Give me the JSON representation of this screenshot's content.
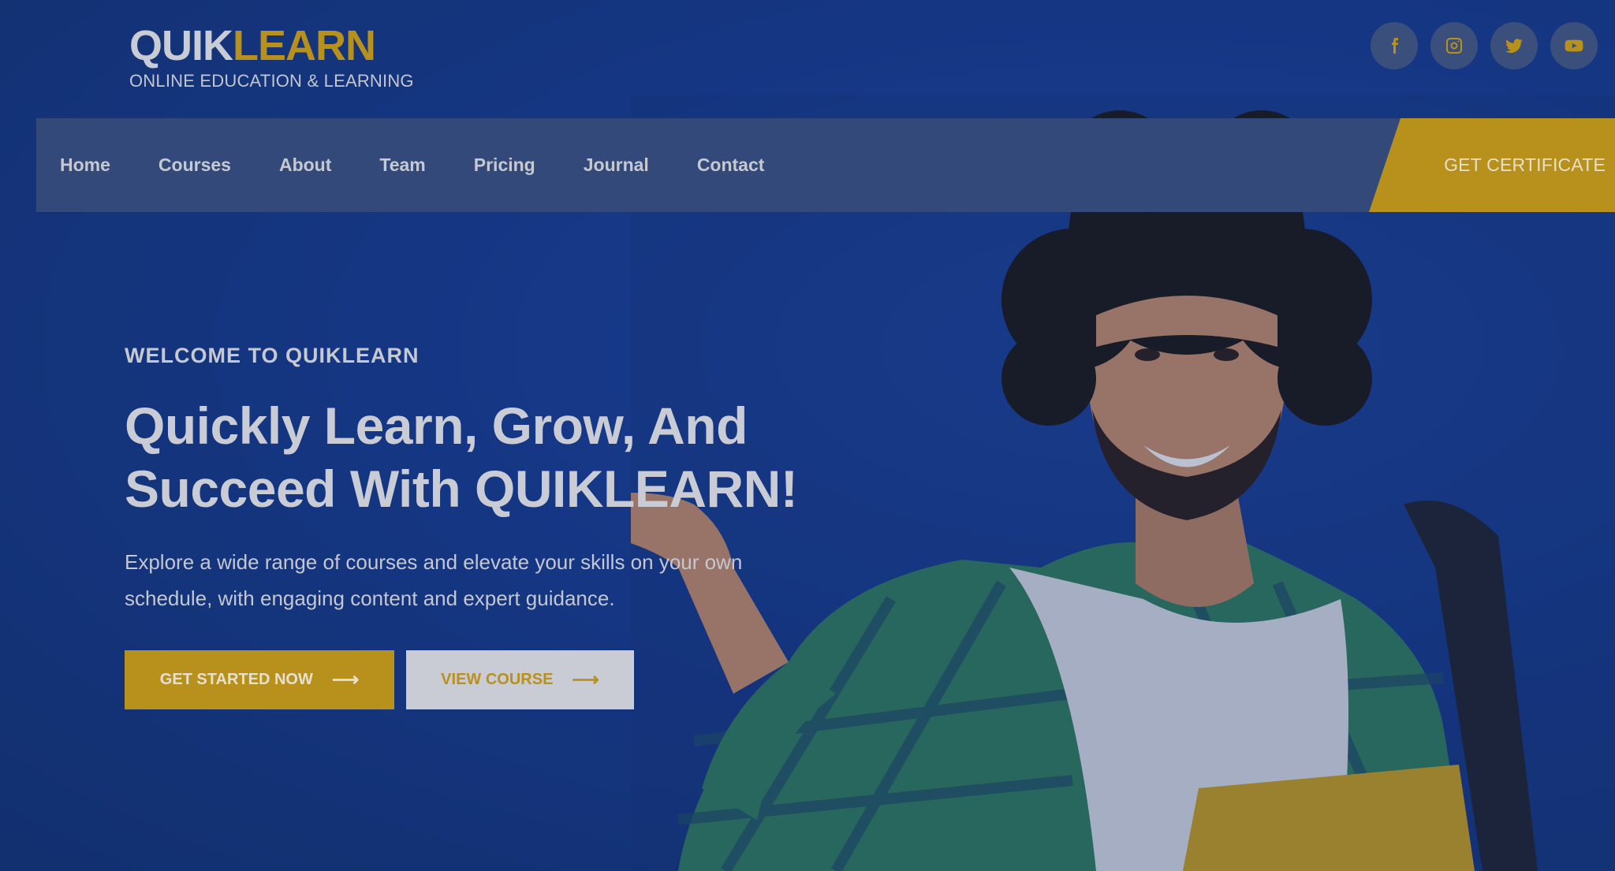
{
  "brand": {
    "name_part1": "QUIK",
    "name_part2": "LEARN",
    "tagline": "ONLINE EDUCATION & LEARNING"
  },
  "social": [
    {
      "icon": "facebook-icon"
    },
    {
      "icon": "instagram-icon"
    },
    {
      "icon": "twitter-icon"
    },
    {
      "icon": "youtube-icon"
    }
  ],
  "nav": {
    "items": [
      {
        "label": "Home"
      },
      {
        "label": "Courses"
      },
      {
        "label": "About"
      },
      {
        "label": "Team"
      },
      {
        "label": "Pricing"
      },
      {
        "label": "Journal"
      },
      {
        "label": "Contact"
      }
    ],
    "cta": "GET CERTIFICATE"
  },
  "hero": {
    "eyebrow": "WELCOME TO QUIKLEARN",
    "headline_line1": "Quickly Learn, Grow, And",
    "headline_line2": "Succeed With QUIKLEARN!",
    "description_line1": "Explore a wide range of courses and elevate your skills on your own",
    "description_line2": "schedule, with engaging content and expert guidance.",
    "primary_button": "GET STARTED NOW",
    "secondary_button": "VIEW COURSE",
    "arrow": "⟶"
  },
  "colors": {
    "background": "#143580",
    "accent": "#b8901c",
    "nav_bg": "#33497a",
    "text_light": "#c9ccd4"
  }
}
